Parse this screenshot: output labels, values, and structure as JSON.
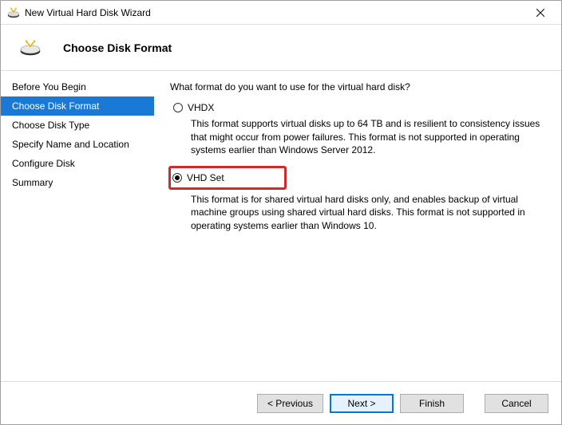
{
  "window": {
    "title": "New Virtual Hard Disk Wizard"
  },
  "header": {
    "title": "Choose Disk Format"
  },
  "sidebar": {
    "steps": [
      {
        "label": "Before You Begin"
      },
      {
        "label": "Choose Disk Format"
      },
      {
        "label": "Choose Disk Type"
      },
      {
        "label": "Specify Name and Location"
      },
      {
        "label": "Configure Disk"
      },
      {
        "label": "Summary"
      }
    ],
    "active_index": 1
  },
  "main": {
    "question": "What format do you want to use for the virtual hard disk?",
    "options": [
      {
        "label": "VHDX",
        "selected": false,
        "desc": "This format supports virtual disks up to 64 TB and is resilient to consistency issues that might occur from power failures. This format is not supported in operating systems earlier than Windows Server 2012."
      },
      {
        "label": "VHD Set",
        "selected": true,
        "highlighted": true,
        "desc": "This format is for shared virtual hard disks only, and enables backup of virtual machine groups using shared virtual hard disks. This format is not supported in operating systems earlier than Windows 10."
      }
    ]
  },
  "footer": {
    "previous": "< Previous",
    "next": "Next >",
    "finish": "Finish",
    "cancel": "Cancel"
  }
}
